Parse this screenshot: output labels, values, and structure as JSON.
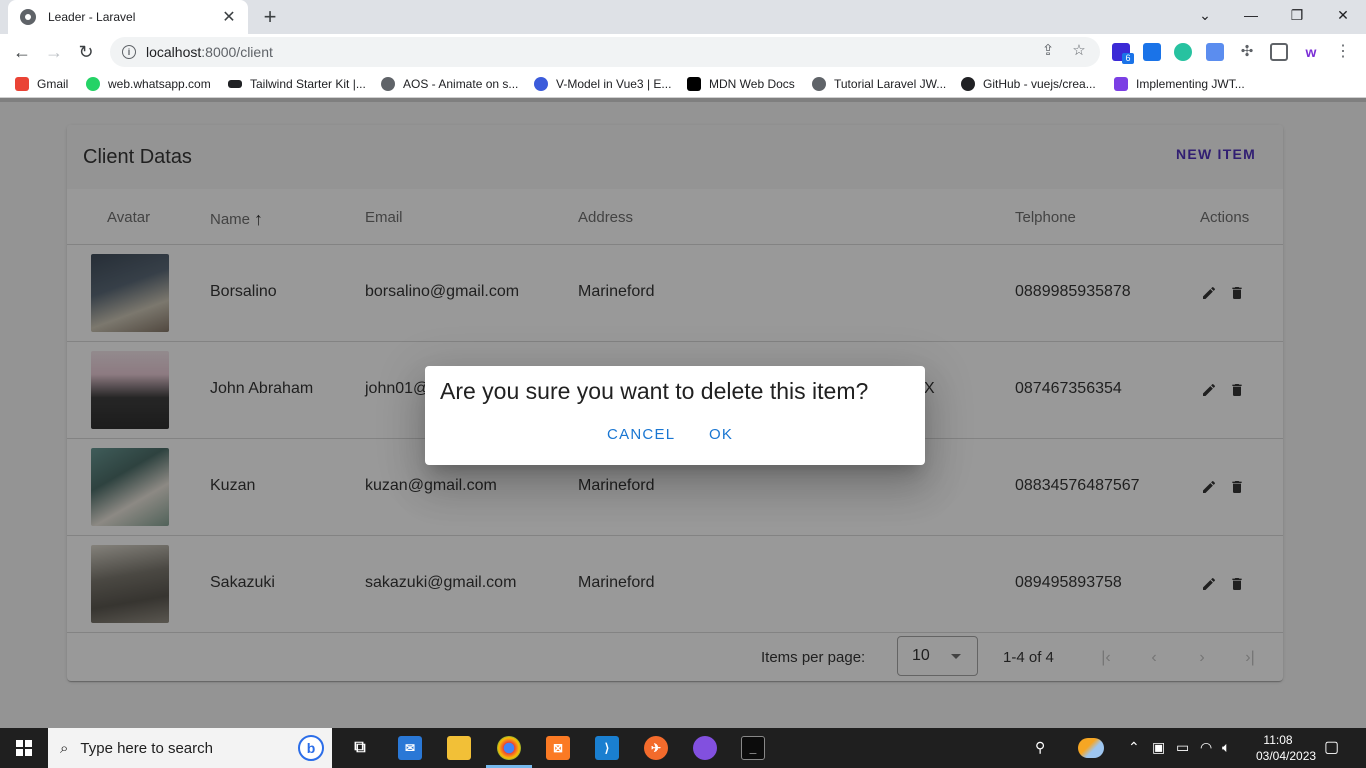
{
  "browser": {
    "tab_title": "Leader - Laravel",
    "url_host": "localhost",
    "url_rest": ":8000/client",
    "bookmarks": [
      {
        "label": "Gmail",
        "color": "#ea4335"
      },
      {
        "label": "web.whatsapp.com",
        "color": "#25d366"
      },
      {
        "label": "Tailwind Starter Kit |...",
        "color": "#202124"
      },
      {
        "label": "AOS - Animate on s...",
        "color": "#5f6368"
      },
      {
        "label": "V-Model in Vue3 | E...",
        "color": "#3b5bdb"
      },
      {
        "label": "MDN Web Docs",
        "color": "#000000"
      },
      {
        "label": "Tutorial Laravel JW...",
        "color": "#5f6368"
      },
      {
        "label": "GitHub - vuejs/crea...",
        "color": "#202124"
      },
      {
        "label": "Implementing JWT...",
        "color": "#7b3fe4"
      }
    ],
    "extensions_badge": "6"
  },
  "card": {
    "title": "Client Datas",
    "new_item_label": "NEW ITEM"
  },
  "table": {
    "headers": {
      "avatar": "Avatar",
      "name": "Name",
      "email": "Email",
      "address": "Address",
      "telphone": "Telphone",
      "actions": "Actions"
    },
    "rows": [
      {
        "name": "Borsalino",
        "email": "borsalino@gmail.com",
        "address": "Marineford",
        "telphone": "0889985935878",
        "avatar_colors": [
          "#3a4a5c",
          "#c9c2b0"
        ]
      },
      {
        "name": "John Abraham",
        "email": "john01@",
        "address": "X",
        "telphone": "087467356354",
        "avatar_colors": [
          "#f3e4ea",
          "#2a2a2a"
        ]
      },
      {
        "name": "Kuzan",
        "email": "kuzan@gmail.com",
        "address": "Marineford",
        "telphone": "08834576487567",
        "avatar_colors": [
          "#5a8f8a",
          "#e8e2d8"
        ]
      },
      {
        "name": "Sakazuki",
        "email": "sakazuki@gmail.com",
        "address": "Marineford",
        "telphone": "089495893758",
        "avatar_colors": [
          "#6e6a60",
          "#d9d4c8"
        ]
      }
    ]
  },
  "pagination": {
    "items_per_page_label": "Items per page:",
    "items_per_page_value": "10",
    "range_text": "1-4 of 4"
  },
  "dialog": {
    "title": "Are you sure you want to delete this item?",
    "cancel_label": "Cancel",
    "ok_label": "OK"
  },
  "taskbar": {
    "search_placeholder": "Type here to search",
    "time": "11:08",
    "date": "03/04/2023"
  },
  "colors": {
    "accent": "#3f1db8",
    "dialog_button": "#1976d2"
  }
}
